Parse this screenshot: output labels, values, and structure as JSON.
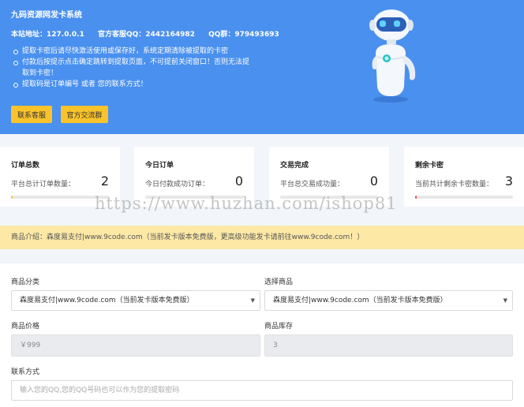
{
  "header": {
    "title": "九码资源网发卡系统",
    "site_address": "本站地址：127.0.0.1",
    "qq_service": "官方客服QQ：2442164982",
    "qq_group": "QQ群：979493693",
    "notices": [
      "提取卡密后请尽快激活使用或保存好，系统定期清除被提取的卡密",
      "付款后按提示点击确定跳转到提取页面，不可提前关闭窗口！否则无法提取到卡密！",
      "提取码是订单编号 或者 您的联系方式！"
    ],
    "contact_button": "联系客服",
    "group_button": "官方交流群"
  },
  "stats": [
    {
      "title": "订单总数",
      "desc": "平台总计订单数量：",
      "value": "2",
      "bar_color": "#f9c32b",
      "bar_fraction": 0.02
    },
    {
      "title": "今日订单",
      "desc": "今日付款成功订单：",
      "value": "0",
      "bar_color": "#4a90ee",
      "bar_fraction": 0
    },
    {
      "title": "交易完成",
      "desc": "平台总交易成功量：",
      "value": "0",
      "bar_color": "#4a90ee",
      "bar_fraction": 0
    },
    {
      "title": "剩余卡密",
      "desc": "当前共计剩余卡密数量：",
      "value": "3",
      "bar_color": "#e64a4a",
      "bar_fraction": 0.02
    }
  ],
  "watermark": "https://www.huzhan.com/ishop81",
  "intro": "商品介绍：森度易支付|www.9code.com（当前发卡版本免费版，更高级功能发卡请前往www.9code.com！）",
  "form": {
    "category_label": "商品分类",
    "category_value": "森度易支付|www.9code.com（当前发卡版本免费版）",
    "product_label": "选择商品",
    "product_value": "森度易支付|www.9code.com（当前发卡版本免费版）",
    "price_label": "商品价格",
    "price_value": "￥999",
    "stock_label": "商品库存",
    "stock_value": "3",
    "contact_label": "联系方式",
    "contact_placeholder": "输入您的QQ,您的QQ号码也可以作为您的提取密码"
  }
}
